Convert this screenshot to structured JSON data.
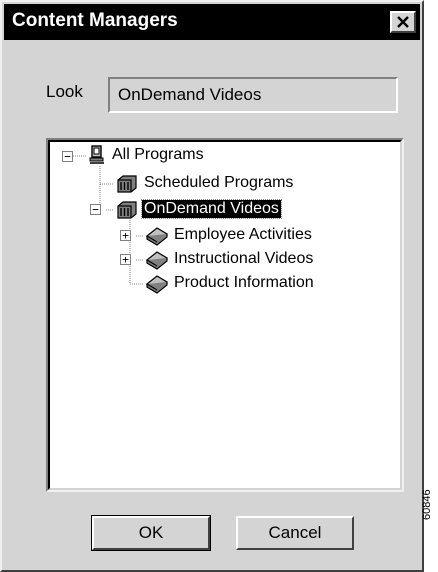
{
  "window": {
    "title": "Content Managers",
    "close_glyph": "✕"
  },
  "look": {
    "label": "Look",
    "value": "OnDemand Videos"
  },
  "tree": {
    "root": {
      "label": "All Programs",
      "icon": "computer-icon"
    },
    "scheduled": {
      "label": "Scheduled Programs",
      "icon": "programs-icon"
    },
    "ondemand": {
      "label": "OnDemand Videos",
      "icon": "programs-icon"
    },
    "children": [
      {
        "label": "Employee Activities",
        "icon": "book-icon"
      },
      {
        "label": "Instructional Videos",
        "icon": "book-icon"
      },
      {
        "label": "Product Information",
        "icon": "book-icon"
      }
    ],
    "minus": "−",
    "plus": "+"
  },
  "buttons": {
    "ok": "OK",
    "cancel": "Cancel"
  },
  "figure_id": "60846"
}
